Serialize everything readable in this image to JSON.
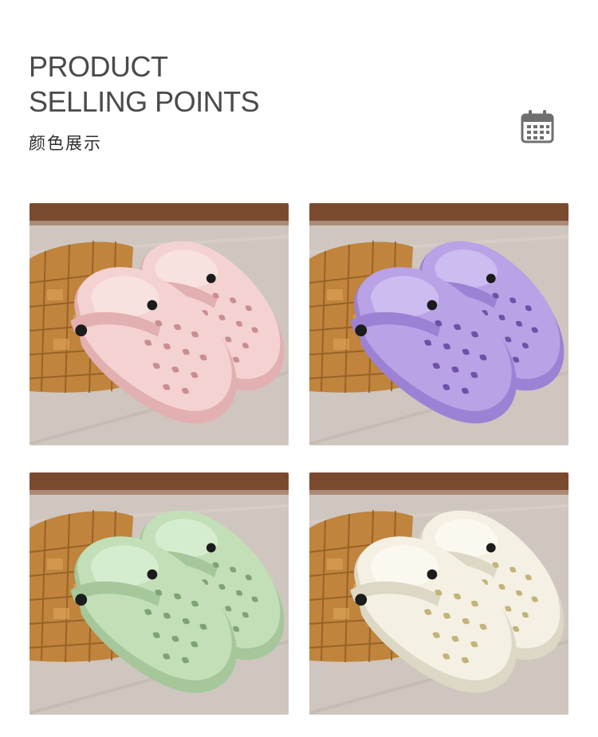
{
  "header": {
    "title_line1": "PRODUCT",
    "title_line2": "SELLING POINTS",
    "subtitle": "颜色展示",
    "icon": "calendar-icon"
  },
  "gallery": {
    "items": [
      {
        "id": "pink",
        "body": "#f5d2d2",
        "shade": "#e2b0b0",
        "insole": "#f8e2e0",
        "hole": "#c98e90"
      },
      {
        "id": "purple",
        "body": "#b9a2e6",
        "shade": "#9c82d4",
        "insole": "#cdbcf0",
        "hole": "#6d52a8"
      },
      {
        "id": "green",
        "body": "#c2dfb8",
        "shade": "#a5c79a",
        "insole": "#d6ecce",
        "hole": "#7fa373"
      },
      {
        "id": "white",
        "body": "#f4f0e4",
        "shade": "#ddd7c5",
        "insole": "#fbf8f0",
        "hole": "#c2b47a"
      }
    ]
  },
  "colors": {
    "title": "#4a4a4a",
    "subtitle": "#2e2e2e",
    "icon": "#6f6f6f",
    "wall": "#7a4a2f",
    "floor": "#cfc6bf",
    "basket": "#c0843c"
  }
}
